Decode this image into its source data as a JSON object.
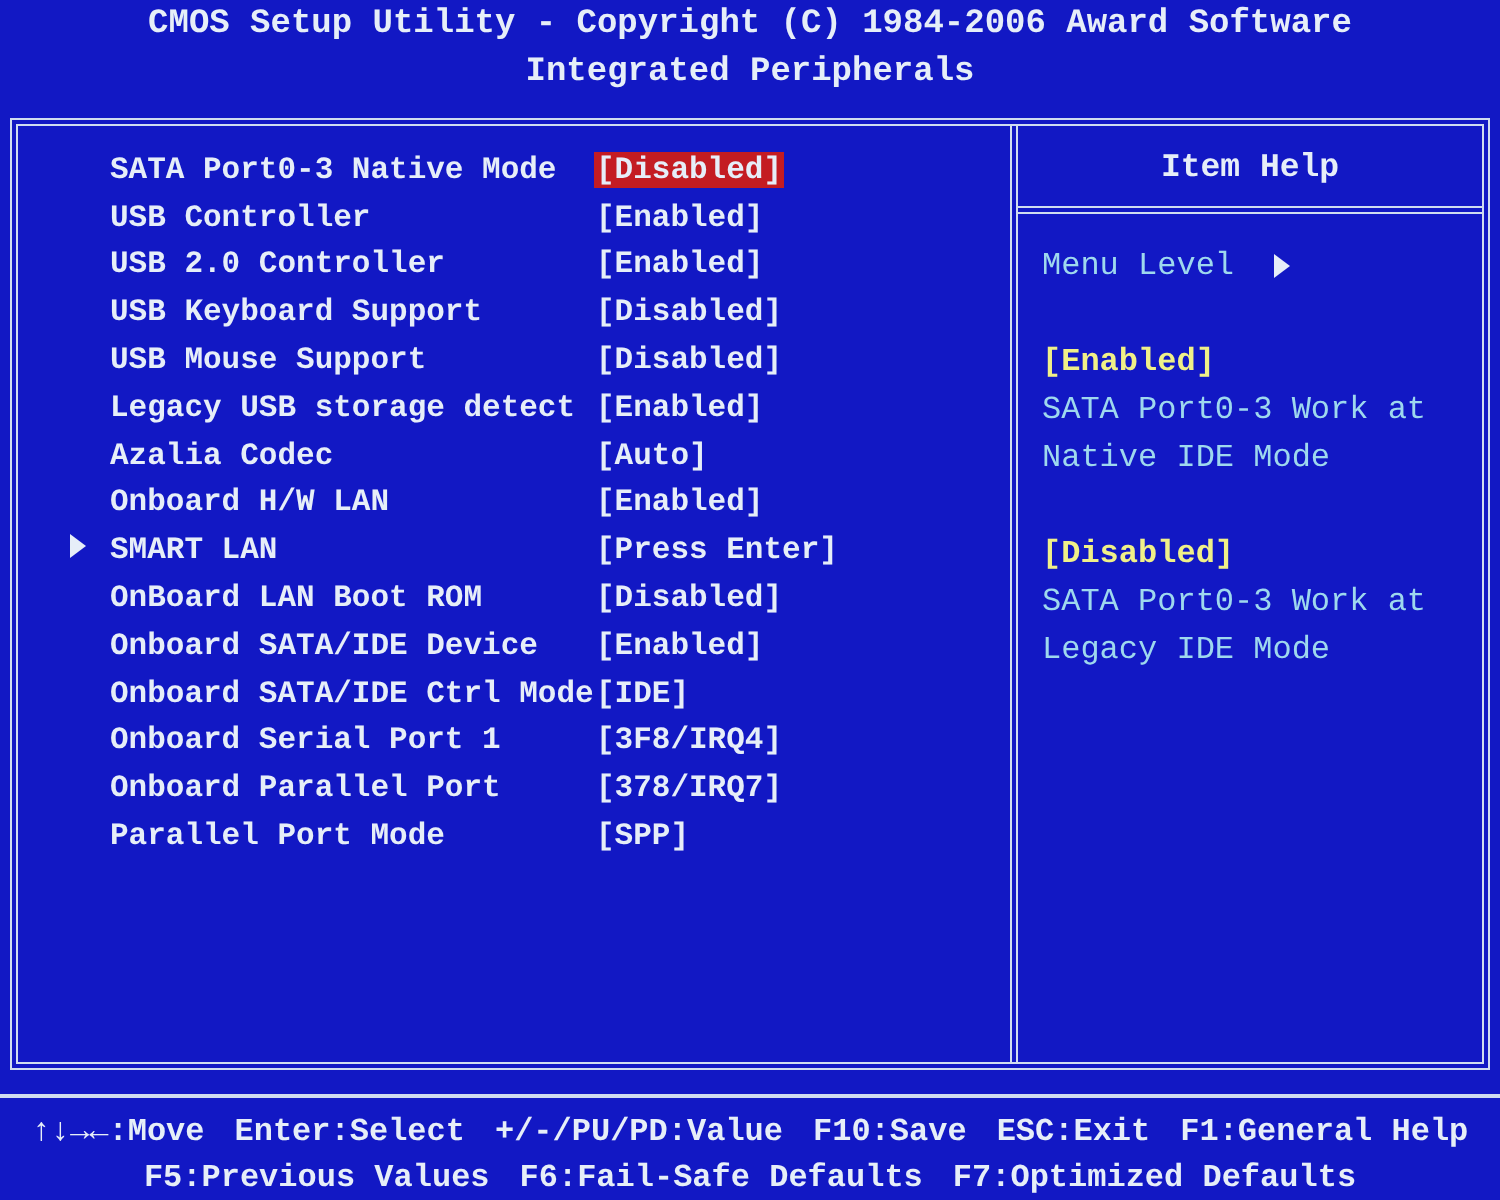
{
  "header": {
    "title": "CMOS Setup Utility - Copyright (C) 1984-2006 Award Software",
    "subtitle": "Integrated Peripherals"
  },
  "settings": [
    {
      "label": "SATA Port0-3 Native Mode",
      "value": "[Disabled]",
      "selected": true,
      "submenu": false
    },
    {
      "label": "USB Controller",
      "value": "[Enabled]",
      "selected": false,
      "submenu": false
    },
    {
      "label": "USB 2.0 Controller",
      "value": "[Enabled]",
      "selected": false,
      "submenu": false
    },
    {
      "label": "USB Keyboard Support",
      "value": "[Disabled]",
      "selected": false,
      "submenu": false
    },
    {
      "label": "USB Mouse Support",
      "value": "[Disabled]",
      "selected": false,
      "submenu": false
    },
    {
      "label": "Legacy USB storage detect",
      "value": "[Enabled]",
      "selected": false,
      "submenu": false
    },
    {
      "label": "Azalia Codec",
      "value": "[Auto]",
      "selected": false,
      "submenu": false
    },
    {
      "label": "Onboard H/W LAN",
      "value": "[Enabled]",
      "selected": false,
      "submenu": false
    },
    {
      "label": "SMART LAN",
      "value": "[Press Enter]",
      "selected": false,
      "submenu": true
    },
    {
      "label": "OnBoard LAN Boot ROM",
      "value": "[Disabled]",
      "selected": false,
      "submenu": false
    },
    {
      "label": "Onboard SATA/IDE Device",
      "value": "[Enabled]",
      "selected": false,
      "submenu": false
    },
    {
      "label": "Onboard SATA/IDE Ctrl Mode",
      "value": "[IDE]",
      "selected": false,
      "submenu": false
    },
    {
      "label": "Onboard Serial Port 1",
      "value": "[3F8/IRQ4]",
      "selected": false,
      "submenu": false
    },
    {
      "label": "Onboard Parallel Port",
      "value": "[378/IRQ7]",
      "selected": false,
      "submenu": false
    },
    {
      "label": "Parallel Port Mode",
      "value": "[SPP]",
      "selected": false,
      "submenu": false
    }
  ],
  "item_help": {
    "title": "Item Help",
    "menu_level": "Menu Level",
    "options": [
      {
        "option": "[Enabled]",
        "lines": [
          "SATA Port0-3 Work at",
          "Native IDE Mode"
        ]
      },
      {
        "option": "[Disabled]",
        "lines": [
          "SATA Port0-3 Work at",
          "Legacy IDE Mode"
        ]
      }
    ]
  },
  "key_help": [
    [
      "↑↓→←:Move",
      "Enter:Select",
      "+/-/PU/PD:Value",
      "F10:Save",
      "ESC:Exit",
      "F1:General Help"
    ],
    [
      "F5:Previous Values",
      "F6:Fail-Safe Defaults",
      "F7:Optimized Defaults"
    ]
  ]
}
